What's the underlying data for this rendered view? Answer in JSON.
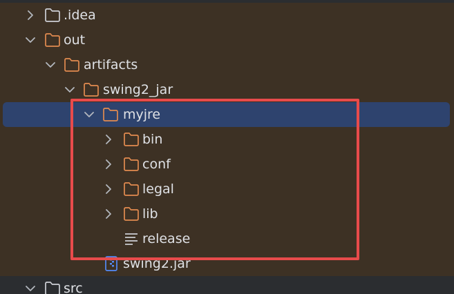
{
  "tree": {
    "items": [
      {
        "label": ".idea",
        "icon": "folder-icon",
        "expanded": false,
        "selected": false
      },
      {
        "label": "out",
        "icon": "folder-icon",
        "expanded": true,
        "selected": false
      },
      {
        "label": "artifacts",
        "icon": "folder-icon",
        "expanded": true,
        "selected": false
      },
      {
        "label": "swing2_jar",
        "icon": "folder-icon",
        "expanded": true,
        "selected": false
      },
      {
        "label": "myjre",
        "icon": "folder-icon",
        "expanded": true,
        "selected": true
      },
      {
        "label": "bin",
        "icon": "folder-icon",
        "expanded": false,
        "selected": false
      },
      {
        "label": "conf",
        "icon": "folder-icon",
        "expanded": false,
        "selected": false
      },
      {
        "label": "legal",
        "icon": "folder-icon",
        "expanded": false,
        "selected": false
      },
      {
        "label": "lib",
        "icon": "folder-icon",
        "expanded": false,
        "selected": false
      },
      {
        "label": "release",
        "icon": "text-file-icon",
        "selected": false
      },
      {
        "label": "swing2.jar",
        "icon": "jar-file-icon",
        "selected": false
      },
      {
        "label": "src",
        "icon": "folder-icon",
        "expanded": true,
        "selected": false
      }
    ]
  },
  "colors": {
    "background": "#2b2d30",
    "ignored_row": "#3d3124",
    "selection": "#2e436e",
    "folder_outline": "#e28b50",
    "highlight_border": "#e84b4b",
    "text": "#dfe1e5"
  }
}
